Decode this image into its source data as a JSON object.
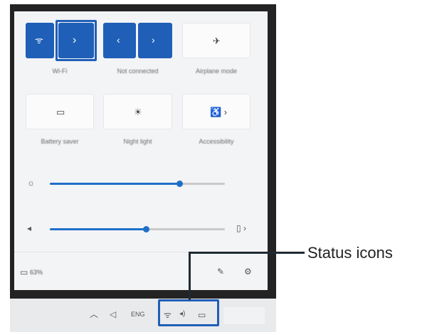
{
  "quick_settings": {
    "tiles": [
      {
        "id": "wifi",
        "label": "Wi-Fi",
        "state": "on",
        "icon": "wifi-icon",
        "glyph": "ᯤ",
        "chevron": "›"
      },
      {
        "id": "bluetooth",
        "label": "Not connected",
        "state": "on",
        "icon": "bluetooth-icon",
        "glyph": "‹",
        "chevron": "›"
      },
      {
        "id": "airplane",
        "label": "Airplane mode",
        "state": "off",
        "icon": "airplane-icon",
        "glyph": "✈"
      },
      {
        "id": "battery-saver",
        "label": "Battery saver",
        "state": "off",
        "icon": "battery-icon",
        "glyph": "▭"
      },
      {
        "id": "night-light",
        "label": "Night light",
        "state": "off",
        "icon": "night-light-icon",
        "glyph": "☀"
      },
      {
        "id": "accessibility",
        "label": "Accessibility",
        "state": "off",
        "icon": "accessibility-icon",
        "glyph": "♿ ›"
      }
    ],
    "brightness": {
      "icon": "brightness-icon",
      "glyph": "☼",
      "level": 0.74
    },
    "volume": {
      "icon": "speaker-icon",
      "glyph": "◂",
      "level": 0.55,
      "device_glyph": "▯ ›"
    },
    "footer": {
      "battery_text": "63%",
      "battery_glyph": "▭",
      "edit_glyph": "✎",
      "settings_glyph": "⚙"
    }
  },
  "taskbar": {
    "chevron_glyph": "︿",
    "pen_glyph": "◁",
    "language": "ENG",
    "status_icons": {
      "wifi": "ᯤ",
      "volume": "◂)",
      "battery": "▭"
    }
  },
  "callout": {
    "label": "Status icons"
  },
  "colors": {
    "accent": "#1f5fb7",
    "frame": "#232323",
    "panel": "#f3f4f6"
  }
}
